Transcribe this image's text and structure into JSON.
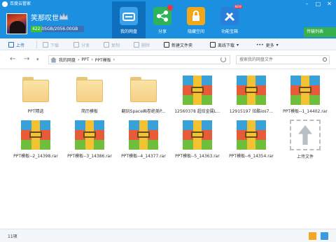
{
  "window": {
    "title": "百度云管家",
    "controls": [
      "minimize-icon",
      "maximize-icon",
      "close-icon"
    ]
  },
  "user": {
    "name": "笑那叹世",
    "quota": "422.05GB/2056.00GB",
    "quota_used_fraction": 0.205,
    "vip_icon": "crown-icon"
  },
  "nav": [
    {
      "label": "我的网盘",
      "icon": "cloud-disk-icon",
      "color": "#3aa0e8",
      "active": true
    },
    {
      "label": "分享",
      "icon": "share-icon",
      "color": "#2fb35a",
      "badge": true
    },
    {
      "label": "隐藏空间",
      "icon": "lock-icon",
      "color": "#f0a81a"
    },
    {
      "label": "功能宝箱",
      "icon": "toolbox-icon",
      "color": "#2a7fd8",
      "new_badge": "NEW"
    }
  ],
  "transfer": {
    "label": "传输列表"
  },
  "toolbar": {
    "upload": "上传",
    "download": "下载",
    "share": "分享",
    "copy": "复制",
    "delete": "删除",
    "new_folder": "新建文件夹",
    "offline_download": "离线下载",
    "more": "更多"
  },
  "address": {
    "crumbs": [
      "我的网盘",
      "PPT",
      "PPT模板"
    ],
    "search_placeholder": "搜索我的网盘文件"
  },
  "files": [
    {
      "name": "PPT精选",
      "type": "folder"
    },
    {
      "name": "简历模板",
      "type": "folder"
    },
    {
      "name": "翻玩Space画卷绝美P...",
      "type": "folder"
    },
    {
      "name": "12560378 超炫金属L...",
      "type": "rar"
    },
    {
      "name": "12915197 炫酷ios7...",
      "type": "rar"
    },
    {
      "name": "PPT模板--1_14402.rar",
      "type": "rar"
    },
    {
      "name": "PPT模板--2_14398.rar",
      "type": "rar"
    },
    {
      "name": "PPT模板--3_14386.rar",
      "type": "rar"
    },
    {
      "name": "PPT模板--4_14377.rar",
      "type": "rar"
    },
    {
      "name": "PPT模板--5_14363.rar",
      "type": "rar"
    },
    {
      "name": "PPT模板--6_14354.rar",
      "type": "rar"
    },
    {
      "name": "上传文件",
      "type": "upload"
    }
  ],
  "status": {
    "count": "11项",
    "icons": [
      "list-view-icon",
      "grid-view-icon"
    ]
  },
  "colors": {
    "header": "#1b8fe0",
    "nav_active": "#0f6fbf",
    "transfer": "#37b04d"
  }
}
